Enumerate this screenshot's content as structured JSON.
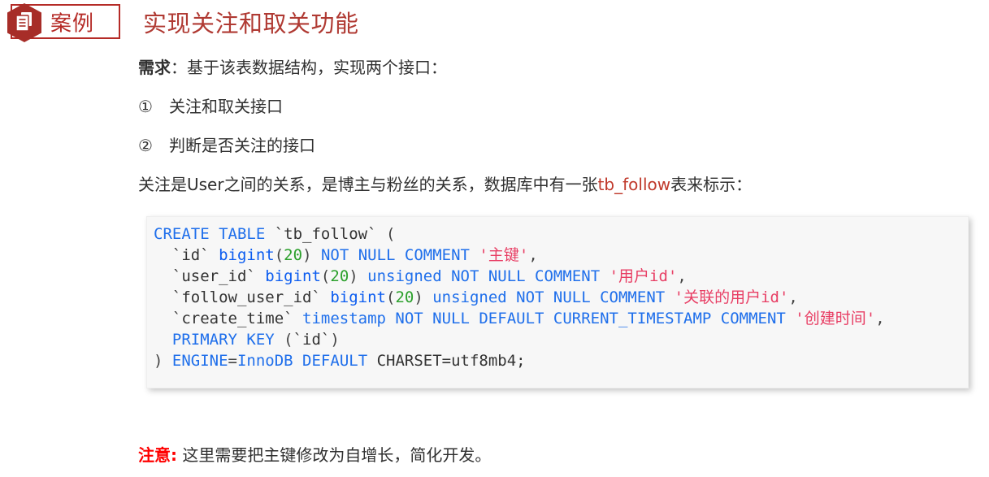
{
  "header": {
    "badge_icon": "document-stack-icon",
    "badge_label": "案例",
    "title": "实现关注和取关功能",
    "title_color": "#b03a33",
    "badge_color": "#b52b27"
  },
  "body": {
    "requirement": {
      "lead": "需求",
      "rest": "：基于该表数据结构，实现两个接口："
    },
    "items": [
      {
        "marker": "①",
        "text": "关注和取关接口"
      },
      {
        "marker": "②",
        "text": "判断是否关注的接口"
      }
    ],
    "description": {
      "before": "关注是User之间的关系，是博主与粉丝的关系，数据库中有一张",
      "highlight": "tb_follow",
      "after": "表来标示：",
      "highlight_color": "#c0392b"
    }
  },
  "code": {
    "language": "sql",
    "lines": [
      [
        {
          "t": "CREATE TABLE ",
          "c": "k"
        },
        {
          "t": "`tb_follow` ",
          "c": "id"
        },
        {
          "t": "(",
          "c": "pn"
        }
      ],
      [
        {
          "t": "  `id` ",
          "c": "id"
        },
        {
          "t": "bigint",
          "c": "kb"
        },
        {
          "t": "(",
          "c": "pn"
        },
        {
          "t": "20",
          "c": "num"
        },
        {
          "t": ") ",
          "c": "pn"
        },
        {
          "t": "NOT NULL COMMENT ",
          "c": "k"
        },
        {
          "t": "'主键'",
          "c": "str"
        },
        {
          "t": ",",
          "c": "pn"
        }
      ],
      [
        {
          "t": "  `user_id` ",
          "c": "id"
        },
        {
          "t": "bigint",
          "c": "kb"
        },
        {
          "t": "(",
          "c": "pn"
        },
        {
          "t": "20",
          "c": "num"
        },
        {
          "t": ") ",
          "c": "pn"
        },
        {
          "t": "unsigned NOT NULL COMMENT ",
          "c": "k"
        },
        {
          "t": "'用户id'",
          "c": "str"
        },
        {
          "t": ",",
          "c": "pn"
        }
      ],
      [
        {
          "t": "  `follow_user_id` ",
          "c": "id"
        },
        {
          "t": "bigint",
          "c": "kb"
        },
        {
          "t": "(",
          "c": "pn"
        },
        {
          "t": "20",
          "c": "num"
        },
        {
          "t": ") ",
          "c": "pn"
        },
        {
          "t": "unsigned NOT NULL COMMENT ",
          "c": "k"
        },
        {
          "t": "'关联的用户id'",
          "c": "str"
        },
        {
          "t": ",",
          "c": "pn"
        }
      ],
      [
        {
          "t": "  `create_time` ",
          "c": "id"
        },
        {
          "t": "timestamp NOT NULL DEFAULT CURRENT_TIMESTAMP COMMENT ",
          "c": "k"
        },
        {
          "t": "'创建时间'",
          "c": "str"
        },
        {
          "t": ",",
          "c": "pn"
        }
      ],
      [
        {
          "t": "  PRIMARY KEY ",
          "c": "k"
        },
        {
          "t": "(",
          "c": "pn"
        },
        {
          "t": "`id`",
          "c": "id"
        },
        {
          "t": ")",
          "c": "pn"
        }
      ],
      [
        {
          "t": ") ",
          "c": "pn"
        },
        {
          "t": "ENGINE",
          "c": "k"
        },
        {
          "t": "=",
          "c": "pn"
        },
        {
          "t": "InnoDB DEFAULT ",
          "c": "k"
        },
        {
          "t": "CHARSET=utf8mb4;",
          "c": "id"
        }
      ]
    ]
  },
  "note": {
    "label": "注意:",
    "text": " 这里需要把主键修改为自增长，简化开发。",
    "label_color": "#ff0000"
  }
}
